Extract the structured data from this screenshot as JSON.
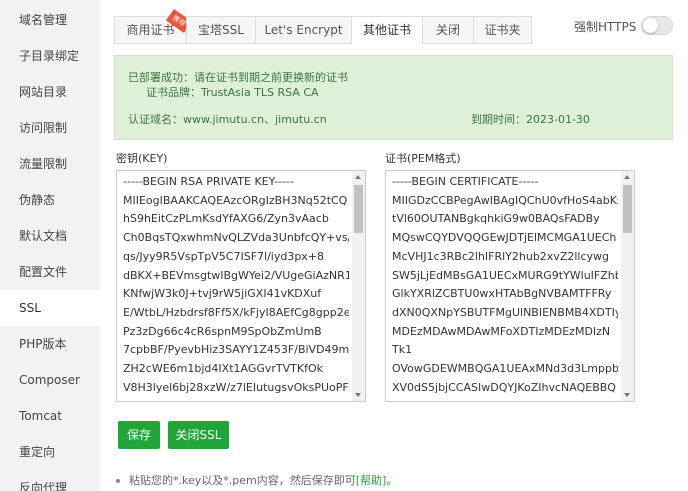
{
  "sidebar": {
    "items": [
      {
        "label": "域名管理"
      },
      {
        "label": "子目录绑定"
      },
      {
        "label": "网站目录"
      },
      {
        "label": "访问限制"
      },
      {
        "label": "流量限制"
      },
      {
        "label": "伪静态"
      },
      {
        "label": "默认文档"
      },
      {
        "label": "配置文件"
      },
      {
        "label": "SSL"
      },
      {
        "label": "PHP版本"
      },
      {
        "label": "Composer"
      },
      {
        "label": "Tomcat"
      },
      {
        "label": "重定向"
      },
      {
        "label": "反向代理"
      }
    ]
  },
  "tabs": [
    {
      "label": "商用证书",
      "badge": "推荐"
    },
    {
      "label": "宝塔SSL"
    },
    {
      "label": "Let's Encrypt"
    },
    {
      "label": "其他证书"
    },
    {
      "label": "关闭"
    },
    {
      "label": "证书夹"
    }
  ],
  "https": {
    "label": "强制HTTPS"
  },
  "info": {
    "deploy_label": "已部署成功：",
    "deploy_text": "请在证书到期之前更换新的证书",
    "brand_label": "证书品牌：",
    "brand_value": "TrustAsia TLS RSA CA",
    "domain_label": "认证域名：",
    "domain_value": "www.jimutu.cn、jimutu.cn",
    "expire_label": "到期时间：",
    "expire_value": "2023-01-30"
  },
  "key": {
    "label": "密钥(KEY)",
    "content": "-----BEGIN RSA PRIVATE KEY-----\nMIIEogIBAAKCAQEAzcORgIzBH3Nq52tCQ\nhS9hEitCzPLmKsdYfAXG6/Zyn3vAacb\nCh0BqsTQxwhmNvQLZVda3UnbfcQY+vs/\nqs/Jyy9R5VspTpV5C7ISF7l/iyd3px+8\ndBKX+BEVmsgtwIBgWYei2/VUgeGiAzNR1\nKNfwjW3k0J+tvj9rW5jiGXI41vKDXuf\nE/WtbL/Hzbdrsf8Ff5X/kFjyI8AEfCg8gpp2e\nPz3zDg66c4cR6spnM9SpObZmUmB\n7cpbBF/PyevbHiz3SAYY1Z453F/BiVD49mb\nZH2cWE6m1bjd4IXt1AGGvrTVTKfOk\nV8H3lyel6bj28xzW/z7lEIutugsvOksPUoPFZ"
  },
  "cert": {
    "label": "证书(PEM格式)",
    "content": "-----BEGIN CERTIFICATE-----\nMIIGDzCCBPegAwIBAgIQChU0vfHoS4abKs\ntVl60OUTANBgkqhkiG9w0BAQsFADBy\nMQswCQYDVQQGEwJDTjElMCMGA1UECh\nMcVHJ1c3RBc2lhIFRlY2hub2xvZ2llcywg\nSW5jLjEdMBsGA1UECxMURG9tYWluIFZhb\nGlkYXRlZCBTU0wxHTAbBgNVBAMTFFRy\ndXN0QXNpYSBUTFMgUlNBIENBMB4XDTIy\nMDEzMDAwMDAwMFoXDTIzMDEzMDIzN\nTk1\nOVowGDEWMBQGA1UEAxMNd3d3Lmppb\nXV0dS5jbjCCASIwDQYJKoZIhvcNAQEBBQ"
  },
  "buttons": {
    "save": "保存",
    "close_ssl": "关闭SSL"
  },
  "note": {
    "text": "粘贴您的*.key以及*.pem内容，然后保存即可",
    "help": "[帮助]",
    "end": "。"
  },
  "colors": {
    "accent": "#20a53a",
    "info_bg": "#dff0d8",
    "info_text": "#3c763d",
    "badge": "#e8553c"
  }
}
